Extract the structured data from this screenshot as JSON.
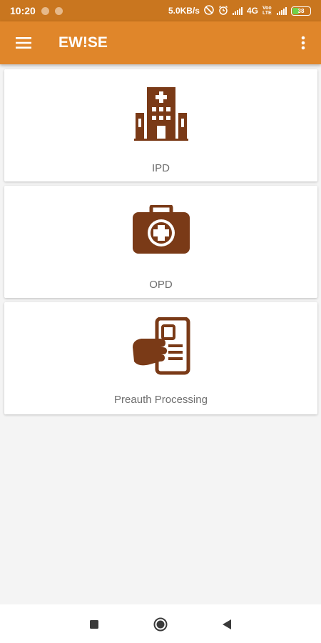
{
  "status_bar": {
    "time": "10:20",
    "network_speed": "5.0KB/s",
    "network_type": "4G",
    "volte": "Voo LTE",
    "battery_level": "38"
  },
  "app_bar": {
    "title": "EW!SE",
    "menu_icon": "hamburger-menu-icon",
    "more_icon": "more-vert-icon"
  },
  "cards": [
    {
      "label": "IPD",
      "icon": "hospital-building-icon"
    },
    {
      "label": "OPD",
      "icon": "medical-kit-icon"
    },
    {
      "label": "Preauth Processing",
      "icon": "hand-holding-card-icon"
    }
  ],
  "nav_bar": {
    "recents_icon": "square-recents-icon",
    "home_icon": "circle-home-icon",
    "back_icon": "triangle-back-icon"
  },
  "colors": {
    "status_bar": "#c9761f",
    "app_bar": "#e0862a",
    "icon_brown": "#7a3a17",
    "background": "#f4f4f4"
  }
}
